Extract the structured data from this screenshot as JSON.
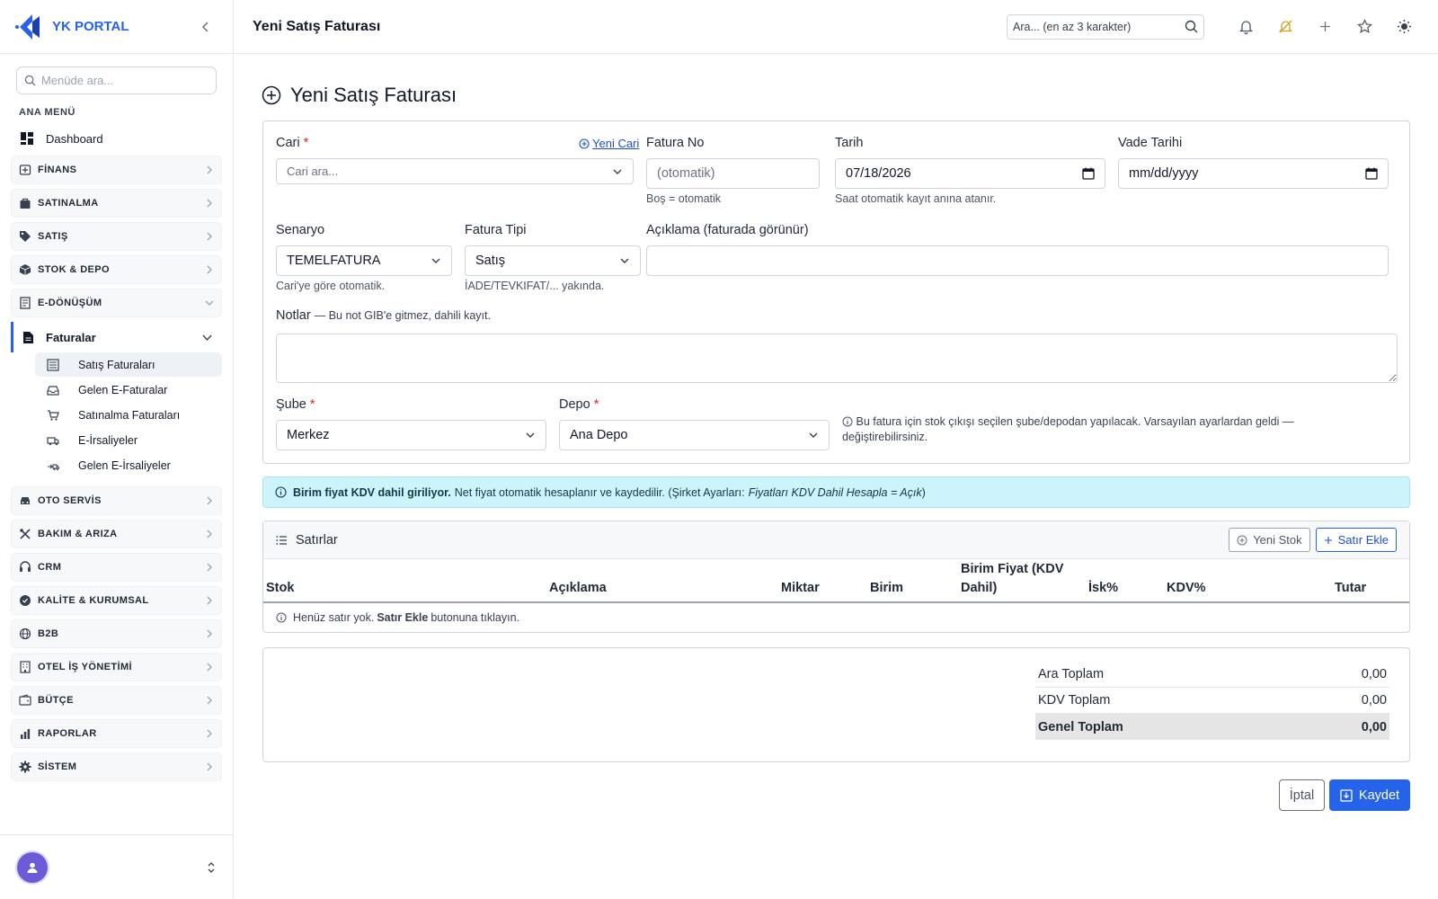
{
  "app": {
    "brand": "YK PORTAL",
    "page_title": "Yeni Satış Faturası"
  },
  "header": {
    "search_placeholder": "Ara... (en az 3 karakter)",
    "icons": [
      "bell-icon",
      "bell-slash-icon",
      "plus-icon",
      "star-icon",
      "sun-icon"
    ]
  },
  "sidebar": {
    "search_placeholder": "Menüde ara...",
    "heading": "ANA MENÜ",
    "dashboard": "Dashboard",
    "groups_top": [
      {
        "label": "FİNANS",
        "icon": "finance-icon"
      },
      {
        "label": "SATINALMA",
        "icon": "bag-icon"
      },
      {
        "label": "SATIŞ",
        "icon": "tag-icon"
      },
      {
        "label": "STOK & DEPO",
        "icon": "box-icon"
      },
      {
        "label": "E-DÖNÜŞÜM",
        "icon": "receipt-icon",
        "expanded": true
      }
    ],
    "faturalar": "Faturalar",
    "sub_items": [
      {
        "label": "Satış Faturaları",
        "active": true
      },
      {
        "label": "Gelen E-Faturalar"
      },
      {
        "label": "Satınalma Faturaları"
      },
      {
        "label": "E-İrsaliyeler"
      },
      {
        "label": "Gelen E-İrsaliyeler"
      }
    ],
    "groups_bottom": [
      {
        "label": "OTO SERVİS"
      },
      {
        "label": "BAKIM & ARIZA"
      },
      {
        "label": "CRM"
      },
      {
        "label": "KALİTE & KURUMSAL"
      },
      {
        "label": "B2B"
      },
      {
        "label": "OTEL İŞ YÖNETİMİ"
      },
      {
        "label": "BÜTÇE"
      },
      {
        "label": "RAPORLAR"
      },
      {
        "label": "SİSTEM"
      }
    ]
  },
  "form": {
    "cari_label": "Cari",
    "required_mark": "*",
    "cari_placeholder": "Cari ara...",
    "new_cari_link": "Yeni Cari",
    "fatura_no_label": "Fatura No",
    "fatura_no_placeholder": "(otomatik)",
    "fatura_no_hint": "Boş = otomatik",
    "tarih_label": "Tarih",
    "tarih_value": "07/18/2026",
    "tarih_hint": "Saat otomatik kayıt anına atanır.",
    "vade_label": "Vade Tarihi",
    "vade_placeholder": "mm/dd/yyyy",
    "senaryo_label": "Senaryo",
    "senaryo_value": "TEMELFATURA",
    "senaryo_hint": "Cari'ye göre otomatik.",
    "fatura_tipi_label": "Fatura Tipi",
    "fatura_tipi_value": "Satış",
    "fatura_tipi_hint": "İADE/TEVKIFAT/... yakında.",
    "aciklama_label": "Açıklama (faturada görünür)",
    "aciklama_value": "",
    "notlar_label": "Notlar",
    "notlar_sub": "— Bu not GIB'e gitmez, dahili kayıt.",
    "sube_label": "Şube",
    "sube_value": "Merkez",
    "depo_label": "Depo",
    "depo_value": "Ana Depo",
    "stock_note": "Bu fatura için stok çıkışı seçilen şube/depodan yapılacak. Varsayılan ayarlardan geldi — değiştirebilirsiniz."
  },
  "info": {
    "bold": "Birim fiyat KDV dahil giriliyor.",
    "text": "Net fiyat otomatik hesaplanır ve kaydedilir. (Şirket Ayarları:",
    "italic": "Fiyatları KDV Dahil Hesapla = Açık",
    "close": ")"
  },
  "lines": {
    "title": "Satırlar",
    "new_stock_button": "Yeni Stok",
    "add_row_button": "Satır Ekle",
    "columns": [
      "Stok",
      "Açıklama",
      "Miktar",
      "Birim",
      "Birim Fiyat (KDV Dahil)",
      "İsk%",
      "KDV%",
      "Tutar"
    ],
    "empty_prefix": "Henüz satır yok.",
    "empty_bold": "Satır Ekle",
    "empty_suffix": "butonuna tıklayın."
  },
  "totals": {
    "rows": [
      {
        "label": "Ara Toplam",
        "value": "0,00"
      },
      {
        "label": "KDV Toplam",
        "value": "0,00"
      },
      {
        "label": "Genel Toplam",
        "value": "0,00"
      }
    ]
  },
  "actions": {
    "cancel": "İptal",
    "save": "Kaydet"
  },
  "colors": {
    "primary": "#2563eb",
    "info_bg": "#cdf4fb",
    "required": "#dc2626",
    "avatar": "#6b5bd6"
  }
}
